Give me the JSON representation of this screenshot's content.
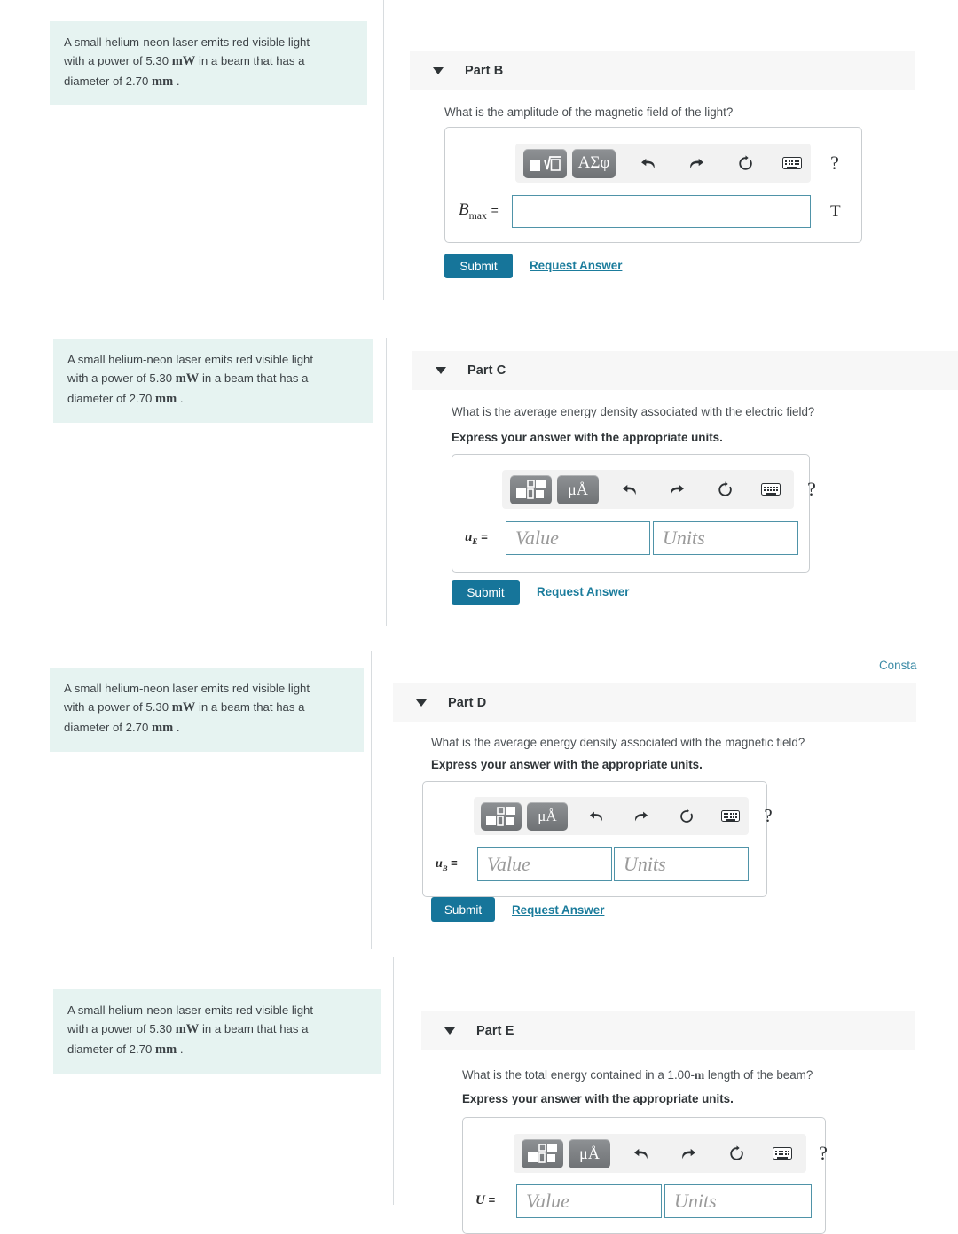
{
  "problem": {
    "line1": "A small helium-neon laser emits red visible light",
    "line2_a": "with a power of 5.30",
    "line2_unit": "mW",
    "line2_b": "in a beam that has a",
    "line3_a": "diameter of 2.70",
    "line3_unit": "mm",
    "line3_b": "."
  },
  "toolbar": {
    "greek_label": "ΑΣφ",
    "units_label": "μÅ",
    "undo_icon": "undo-arrow-icon",
    "redo_icon": "redo-arrow-icon",
    "reset_icon": "reset-circular-arrow-icon",
    "keyboard_icon": "keyboard-icon",
    "help_label": "?"
  },
  "buttons": {
    "submit": "Submit",
    "request_answer": "Request Answer"
  },
  "constants_link": "Consta",
  "placeholders": {
    "value": "Value",
    "units": "Units"
  },
  "colors": {
    "accent": "#16759a",
    "link": "#1b7c9c",
    "blurb_bg": "#e6f3f1",
    "header_bg": "#f7f7f7",
    "field_border": "#4f93a8"
  },
  "parts": [
    {
      "title": "Part B",
      "question": "What is the amplitude of the magnetic field of the light?",
      "express": "",
      "var_base": "B",
      "var_sub": "max",
      "var_eq": "=",
      "answer_unit": "T",
      "input_mode": "single"
    },
    {
      "title": "Part C",
      "question": "What is the average energy density associated with the electric field?",
      "express": "Express your answer with the appropriate units.",
      "var_base": "u",
      "var_sub": "E",
      "var_eq": "=",
      "answer_unit": "",
      "input_mode": "value-units"
    },
    {
      "title": "Part D",
      "question": "What is the average energy density associated with the magnetic field?",
      "express": "Express your answer with the appropriate units.",
      "var_base": "u",
      "var_sub": "B",
      "var_eq": "=",
      "answer_unit": "",
      "input_mode": "value-units"
    },
    {
      "title": "Part E",
      "question_a": "What is the total energy contained in a 1.00-",
      "question_unit": "m",
      "question_b": " length of the beam?",
      "question": "What is the total energy contained in a 1.00-m length of the beam?",
      "express": "Express your answer with the appropriate units.",
      "var_base": "U",
      "var_sub": "",
      "var_eq": "=",
      "answer_unit": "",
      "input_mode": "value-units"
    }
  ]
}
